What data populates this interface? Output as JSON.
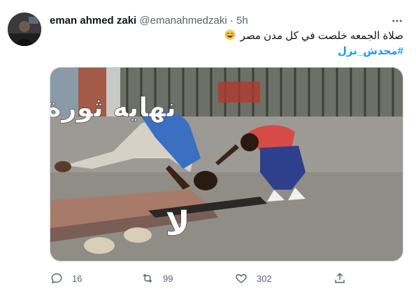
{
  "tweet": {
    "author_name": "eman ahmed zaki",
    "author_handle": "@emanahmedzaki",
    "separator": "·",
    "time": "5h",
    "text": "صلاة الجمعه خلصت في كل مدن مصر",
    "emoji": "joy-emoji",
    "hashtag": "#محدش_نزل",
    "media": {
      "overlay_title": "نهايه ثورة",
      "overlay_no": "لا",
      "description_icon": "photo"
    },
    "actions": {
      "reply": {
        "icon": "reply-icon",
        "count": "16"
      },
      "retweet": {
        "icon": "retweet-icon",
        "count": "99"
      },
      "like": {
        "icon": "heart-icon",
        "count": "302"
      },
      "share": {
        "icon": "share-icon"
      }
    }
  },
  "colors": {
    "text": "#0f1419",
    "secondary": "#536471",
    "link": "#1d9bf0",
    "border": "#cfd9de"
  }
}
